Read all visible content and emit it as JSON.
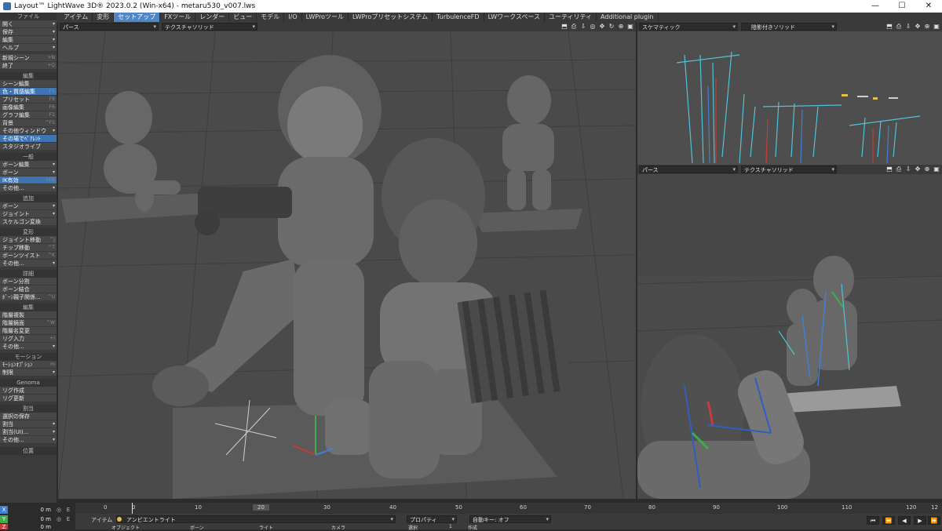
{
  "window": {
    "title": "Layout™ LightWave 3D® 2023.0.2 (Win-x64) - metaru530_v007.lws",
    "controls": [
      "—",
      "☐",
      "✕"
    ]
  },
  "tabs": [
    {
      "label": "アイテム"
    },
    {
      "label": "変形"
    },
    {
      "label": "セットアップ"
    },
    {
      "label": "FXツール"
    },
    {
      "label": "レンダー"
    },
    {
      "label": "ビュー"
    },
    {
      "label": "モデル"
    },
    {
      "label": "I/O"
    },
    {
      "label": "LWProツール"
    },
    {
      "label": "LWProプリセットシステム"
    },
    {
      "label": "TurbulenceFD"
    },
    {
      "label": "LWワークスペース"
    },
    {
      "label": "ユーティリティ"
    },
    {
      "label": "Additional plugin"
    }
  ],
  "active_tab": "セットアップ",
  "sidebar": {
    "file": {
      "head": "ファイル",
      "items": [
        {
          "label": "開く",
          "sc": ""
        },
        {
          "label": "保存",
          "sc": ""
        },
        {
          "label": "編集",
          "sc": ""
        },
        {
          "label": "ヘルプ",
          "sc": ""
        },
        {
          "label": "新規シーン",
          "sc": "+N"
        },
        {
          "label": "終了",
          "sc": "+Q"
        }
      ]
    },
    "edit": {
      "head": "編集",
      "items": [
        {
          "label": "シーン編集",
          "sc": ""
        },
        {
          "label": "色・質感編集",
          "sc": "F5"
        },
        {
          "label": "プリセット",
          "sc": "F8"
        },
        {
          "label": "画像編集",
          "sc": "F6"
        },
        {
          "label": "グラフ編集",
          "sc": "F1"
        },
        {
          "label": "背景",
          "sc": "^F5"
        },
        {
          "label": "その他ウィンドウ",
          "sc": ""
        },
        {
          "label": "その場でﾍﾟｱﾚﾝﾄ",
          "sc": ""
        },
        {
          "label": "スタジオライブ",
          "sc": ""
        }
      ]
    },
    "general": {
      "head": "一般",
      "items": [
        {
          "label": "ボーン編集",
          "sc": ""
        },
        {
          "label": "ボーン",
          "sc": ""
        },
        {
          "label": "IK有効",
          "sc": "+F8"
        },
        {
          "label": "その他...",
          "sc": ""
        }
      ]
    },
    "add": {
      "head": "追加",
      "items": [
        {
          "label": "ボーン",
          "sc": ""
        },
        {
          "label": "ジョイント",
          "sc": ""
        },
        {
          "label": "スケルゴン変換",
          "sc": ""
        }
      ]
    },
    "transform": {
      "head": "変形",
      "items": [
        {
          "label": "ジョイント移動",
          "sc": "^J"
        },
        {
          "label": "チップ移動",
          "sc": "^T"
        },
        {
          "label": "ボーンツイスト",
          "sc": "^K"
        },
        {
          "label": "その他...",
          "sc": ""
        }
      ]
    },
    "detail": {
      "head": "詳細",
      "items": [
        {
          "label": "ボーン分割",
          "sc": ""
        },
        {
          "label": "ボーン結合",
          "sc": ""
        },
        {
          "label": "ﾎﾞｰﾝ親子関係...",
          "sc": "^U"
        }
      ]
    },
    "hier": {
      "head": "編集",
      "items": [
        {
          "label": "階層複製",
          "sc": ""
        },
        {
          "label": "階層鏡面",
          "sc": "^W"
        },
        {
          "label": "階層名変更",
          "sc": ""
        },
        {
          "label": "リグ入力",
          "sc": "+I"
        },
        {
          "label": "その他...",
          "sc": ""
        }
      ]
    },
    "motion": {
      "head": "モーション",
      "items": [
        {
          "label": "ﾓｰｼｮﾝｵﾌﾟｼｮﾝ",
          "sc": "m"
        },
        {
          "label": "制限",
          "sc": ""
        }
      ]
    },
    "genoma": {
      "head": "Genoma",
      "items": [
        {
          "label": "リグ作成",
          "sc": ""
        },
        {
          "label": "リグ更新",
          "sc": ""
        }
      ]
    },
    "assign": {
      "head": "割当",
      "items": [
        {
          "label": "選択の保存",
          "sc": ""
        },
        {
          "label": "割当",
          "sc": ""
        },
        {
          "label": "割当(UI)...",
          "sc": ""
        },
        {
          "label": "その他...",
          "sc": ""
        }
      ]
    },
    "position_label": "位置"
  },
  "viewports": {
    "main": {
      "view": "パース",
      "shading": "テクスチャソリッド"
    },
    "top_right": {
      "view": "スケマティック",
      "shading": "陰影付きソリッド"
    },
    "bottom_right": {
      "view": "パース",
      "shading": "テクスチャソリッド"
    }
  },
  "coords": [
    {
      "axis": "X",
      "value": "0 m",
      "color": "#3f7fd6"
    },
    {
      "axis": "Y",
      "value": "0 m",
      "color": "#3fae4a"
    },
    {
      "axis": "Z",
      "value": "0 m",
      "color": "#c93a3a"
    }
  ],
  "timeline": {
    "ticks": [
      "0",
      "10",
      "20",
      "30",
      "40",
      "50",
      "60",
      "70",
      "80",
      "90",
      "100",
      "110",
      "120"
    ],
    "current": "20",
    "start": "0",
    "end": "12"
  },
  "bottom": {
    "item_label": "アイテム",
    "item_value": "アンビエントライト",
    "property_label": "プロパティ",
    "autokey_label": "自動キー: オフ",
    "sub_labels": [
      "オブジェクト",
      "ボーン",
      "ライト",
      "カメラ",
      "選択",
      "1",
      "作成"
    ]
  },
  "colors": {
    "accent": "#4f86c6",
    "viewport_bg": "#4a4a4a",
    "sidebar_bg": "#3b3b3b"
  }
}
